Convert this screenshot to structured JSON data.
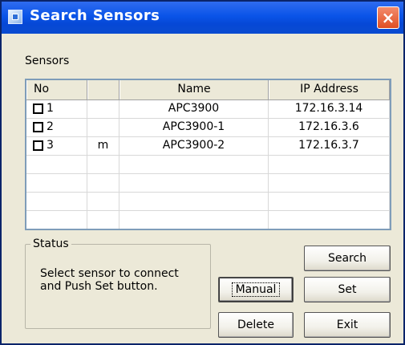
{
  "window": {
    "title": "Search Sensors",
    "close_symbol": "×"
  },
  "sensors": {
    "label": "Sensors",
    "columns": [
      "No",
      "",
      "Name",
      "IP Address"
    ],
    "rows": [
      {
        "no": "1",
        "flag": "",
        "name": "APC3900",
        "ip": "172.16.3.14"
      },
      {
        "no": "2",
        "flag": "",
        "name": "APC3900-1",
        "ip": "172.16.3.6"
      },
      {
        "no": "3",
        "flag": "m",
        "name": "APC3900-2",
        "ip": "172.16.3.7"
      },
      {
        "no": "",
        "flag": "",
        "name": "",
        "ip": ""
      },
      {
        "no": "",
        "flag": "",
        "name": "",
        "ip": ""
      },
      {
        "no": "",
        "flag": "",
        "name": "",
        "ip": ""
      },
      {
        "no": "",
        "flag": "",
        "name": "",
        "ip": ""
      }
    ]
  },
  "status": {
    "title": "Status",
    "message": "Select sensor to connect and Push Set button."
  },
  "buttons": {
    "search": "Search",
    "manual": "Manual",
    "set": "Set",
    "delete": "Delete",
    "exit": "Exit"
  },
  "icons": {
    "app": "sensor-window-icon",
    "close": "close-icon",
    "checkbox": "checkbox-icon"
  },
  "colors": {
    "title_bar": "#0a54e8",
    "close_button": "#e04f24",
    "dialog_background": "#ece9d8"
  }
}
